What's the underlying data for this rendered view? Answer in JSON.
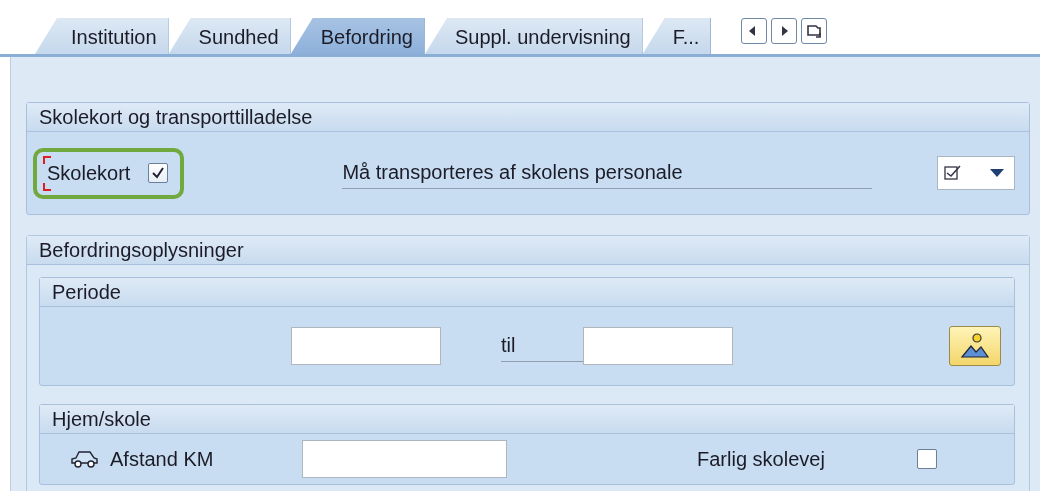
{
  "tabs": [
    {
      "label": "Institution",
      "selected": false
    },
    {
      "label": "Sundhed",
      "selected": false
    },
    {
      "label": "Befordring",
      "selected": true
    },
    {
      "label": "Suppl. undervisning",
      "selected": false
    },
    {
      "label": "F...",
      "selected": false
    }
  ],
  "sections": [
    {
      "title": "Skolekort og transporttilladelse",
      "kind": "card",
      "skolekort": {
        "label": "Skolekort",
        "checked": true,
        "highlighted": true
      },
      "transport": {
        "label": "Må transporteres af skolens personale",
        "checked": true
      }
    },
    {
      "title": "Befordringsoplysninger",
      "kind": "groups",
      "groups": [
        {
          "title": "Periode",
          "kind": "period",
          "to_label": "til"
        },
        {
          "title": "Hjem/skole",
          "kind": "home",
          "distance_label": "Afstand KM",
          "danger_label": "Farlig skolevej",
          "danger_checked": false
        }
      ]
    }
  ]
}
